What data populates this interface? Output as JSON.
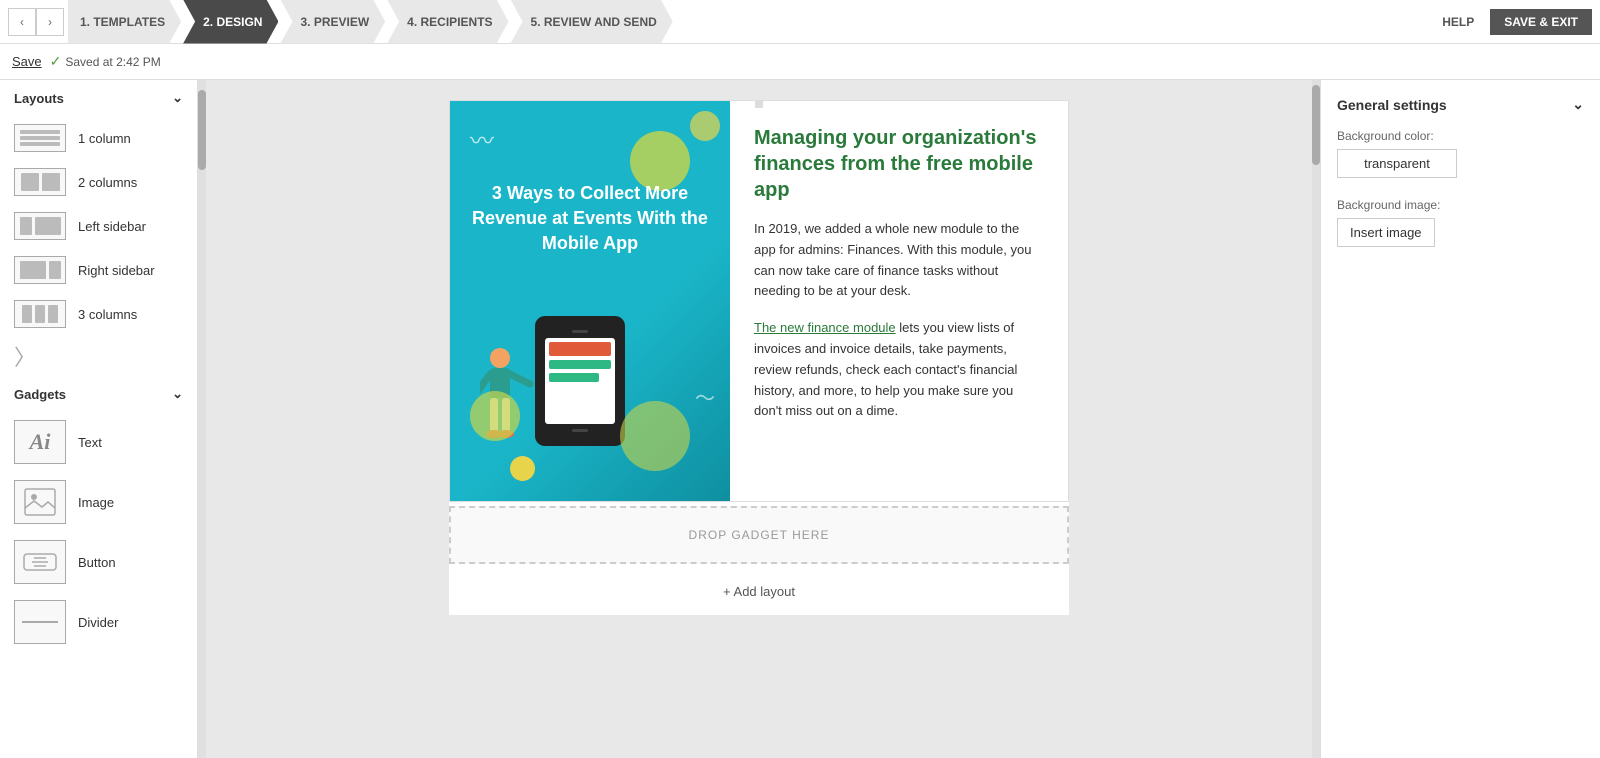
{
  "nav": {
    "steps": [
      {
        "id": "templates",
        "label": "1. TEMPLATES",
        "active": false
      },
      {
        "id": "design",
        "label": "2. DESIGN",
        "active": true
      },
      {
        "id": "preview",
        "label": "3. PREVIEW",
        "active": false
      },
      {
        "id": "recipients",
        "label": "4. RECIPIENTS",
        "active": false
      },
      {
        "id": "review-send",
        "label": "5. REVIEW AND SEND",
        "active": false
      }
    ],
    "help_label": "HELP",
    "save_exit_label": "SAVE & EXIT"
  },
  "toolbar": {
    "save_label": "Save",
    "saved_status": "Saved at 2:42 PM"
  },
  "sidebar": {
    "layouts_label": "Layouts",
    "gadgets_label": "Gadgets",
    "layouts": [
      {
        "id": "1-column",
        "label": "1 column",
        "type": "1col"
      },
      {
        "id": "2-columns",
        "label": "2 columns",
        "type": "2col"
      },
      {
        "id": "left-sidebar",
        "label": "Left sidebar",
        "type": "left-sidebar"
      },
      {
        "id": "right-sidebar",
        "label": "Right sidebar",
        "type": "right-sidebar"
      },
      {
        "id": "3-columns",
        "label": "3 columns",
        "type": "3col"
      }
    ],
    "gadgets": [
      {
        "id": "text",
        "label": "Text",
        "icon": "Ai"
      },
      {
        "id": "image",
        "label": "Image",
        "icon": "🖼"
      },
      {
        "id": "button",
        "label": "Button",
        "icon": "⊞"
      },
      {
        "id": "divider",
        "label": "Divider",
        "icon": "—"
      }
    ]
  },
  "canvas": {
    "content_title": "Managing your organization's finances from the free mobile app",
    "content_body_1": "In 2019, we added a whole new module to the app for admins: Finances. With this module, you can now take care of finance tasks without needing to be at your desk.",
    "content_link_text": "The new finance module",
    "content_body_2": " lets you view lists of invoices and invoice details, take payments, review refunds, check each contact's financial history, and more, to help you make sure you don't miss out on a dime.",
    "image_text": "3 Ways to Collect More Revenue at Events With the Mobile App",
    "drop_zone_label": "DROP GADGET HERE",
    "add_layout_label": "+ Add layout"
  },
  "right_panel": {
    "title": "General settings",
    "bg_color_label": "Background color:",
    "bg_color_value": "transparent",
    "bg_image_label": "Background image:",
    "insert_image_label": "Insert image"
  }
}
